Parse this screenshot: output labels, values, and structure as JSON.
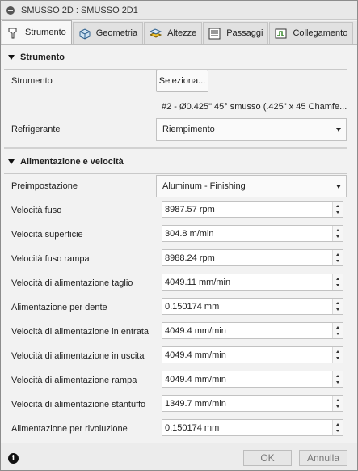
{
  "window": {
    "title": "SMUSSO 2D : SMUSSO 2D1"
  },
  "tabs": [
    {
      "label": "Strumento",
      "icon": "tool-icon",
      "active": true
    },
    {
      "label": "Geometria",
      "icon": "geometry-cube-icon"
    },
    {
      "label": "Altezze",
      "icon": "heights-icon"
    },
    {
      "label": "Passaggi",
      "icon": "passes-icon"
    },
    {
      "label": "Collegamento",
      "icon": "linking-icon"
    }
  ],
  "tool_section": {
    "title": "Strumento",
    "tool_label": "Strumento",
    "select_button": "Seleziona...",
    "tool_description": "#2 - Ø0.425\" 45° smusso (.425\" x 45 Chamfe...",
    "coolant_label": "Refrigerante",
    "coolant_value": "Riempimento"
  },
  "feed_section": {
    "title": "Alimentazione e velocità",
    "preset_label": "Preimpostazione",
    "preset_value": "Aluminum - Finishing",
    "fields": [
      {
        "label": "Velocità fuso",
        "value": "8987.57 rpm"
      },
      {
        "label": "Velocità superficie",
        "value": "304.8 m/min"
      },
      {
        "label": "Velocità fuso rampa",
        "value": "8988.24 rpm"
      },
      {
        "label": "Velocità di alimentazione taglio",
        "value": "4049.11 mm/min"
      },
      {
        "label": "Alimentazione per dente",
        "value": "0.150174 mm"
      },
      {
        "label": "Velocità di alimentazione in entrata",
        "value": "4049.4 mm/min"
      },
      {
        "label": "Velocità di alimentazione in uscita",
        "value": "4049.4 mm/min"
      },
      {
        "label": "Velocità di alimentazione rampa",
        "value": "4049.4 mm/min"
      },
      {
        "label": "Velocità di alimentazione stantuffo",
        "value": "1349.7 mm/min"
      },
      {
        "label": "Alimentazione per rivoluzione",
        "value": "0.150174 mm"
      }
    ]
  },
  "footer": {
    "ok": "OK",
    "cancel": "Annulla",
    "info_icon": "info-icon"
  }
}
